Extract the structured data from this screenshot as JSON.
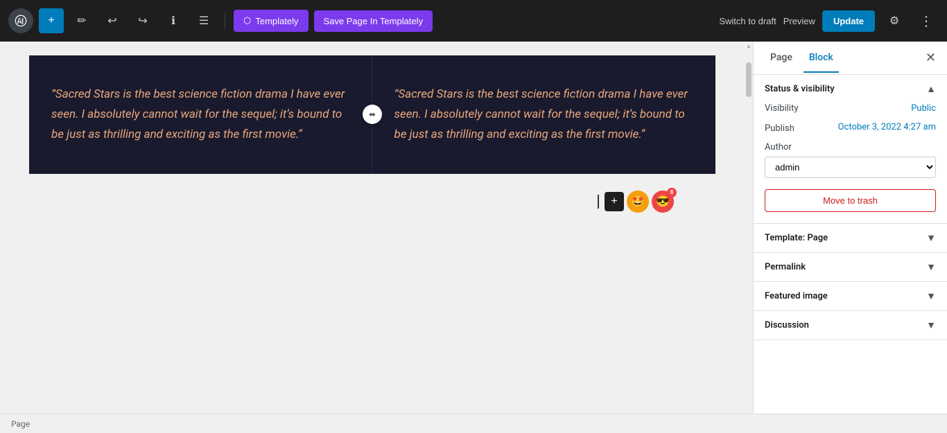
{
  "toolbar": {
    "add_label": "+",
    "edit_icon": "✏",
    "undo_icon": "↩",
    "redo_icon": "↪",
    "info_icon": "ℹ",
    "list_icon": "☰",
    "templately_label": "Templately",
    "save_page_label": "Save Page In Templately",
    "switch_draft_label": "Switch to draft",
    "preview_label": "Preview",
    "update_label": "Update",
    "settings_icon": "⚙",
    "more_icon": "⋮"
  },
  "editor": {
    "col1_text": "“Sacred Stars is the best science fiction drama I have ever seen. I absolutely cannot wait for the sequel; it’s bound to be just as thrilling and exciting as the first movie.”",
    "col2_text": "“Sacred Stars is the best science fiction drama I have ever seen. I absolutely cannot wait for the sequel; it’s bound to be just as thrilling and exciting as the first movie.”",
    "resize_icon": "⬌"
  },
  "sidebar": {
    "page_tab": "Page",
    "block_tab": "Block",
    "close_icon": "✕",
    "status_visibility_label": "Status & visibility",
    "visibility_label": "Visibility",
    "visibility_value": "Public",
    "publish_label": "Publish",
    "publish_value": "October 3, 2022 4:27 am",
    "author_label": "Author",
    "author_value": "admin",
    "author_options": [
      "admin"
    ],
    "move_trash_label": "Move to trash",
    "template_label": "Template: Page",
    "permalink_label": "Permalink",
    "featured_image_label": "Featured image",
    "discussion_label": "Discussion",
    "chevron_up": "▲",
    "chevron_down": "▼"
  },
  "status_bar": {
    "text": "Page"
  },
  "avatars": {
    "emoji1": "🤩",
    "emoji2": "😎",
    "badge": "8"
  }
}
